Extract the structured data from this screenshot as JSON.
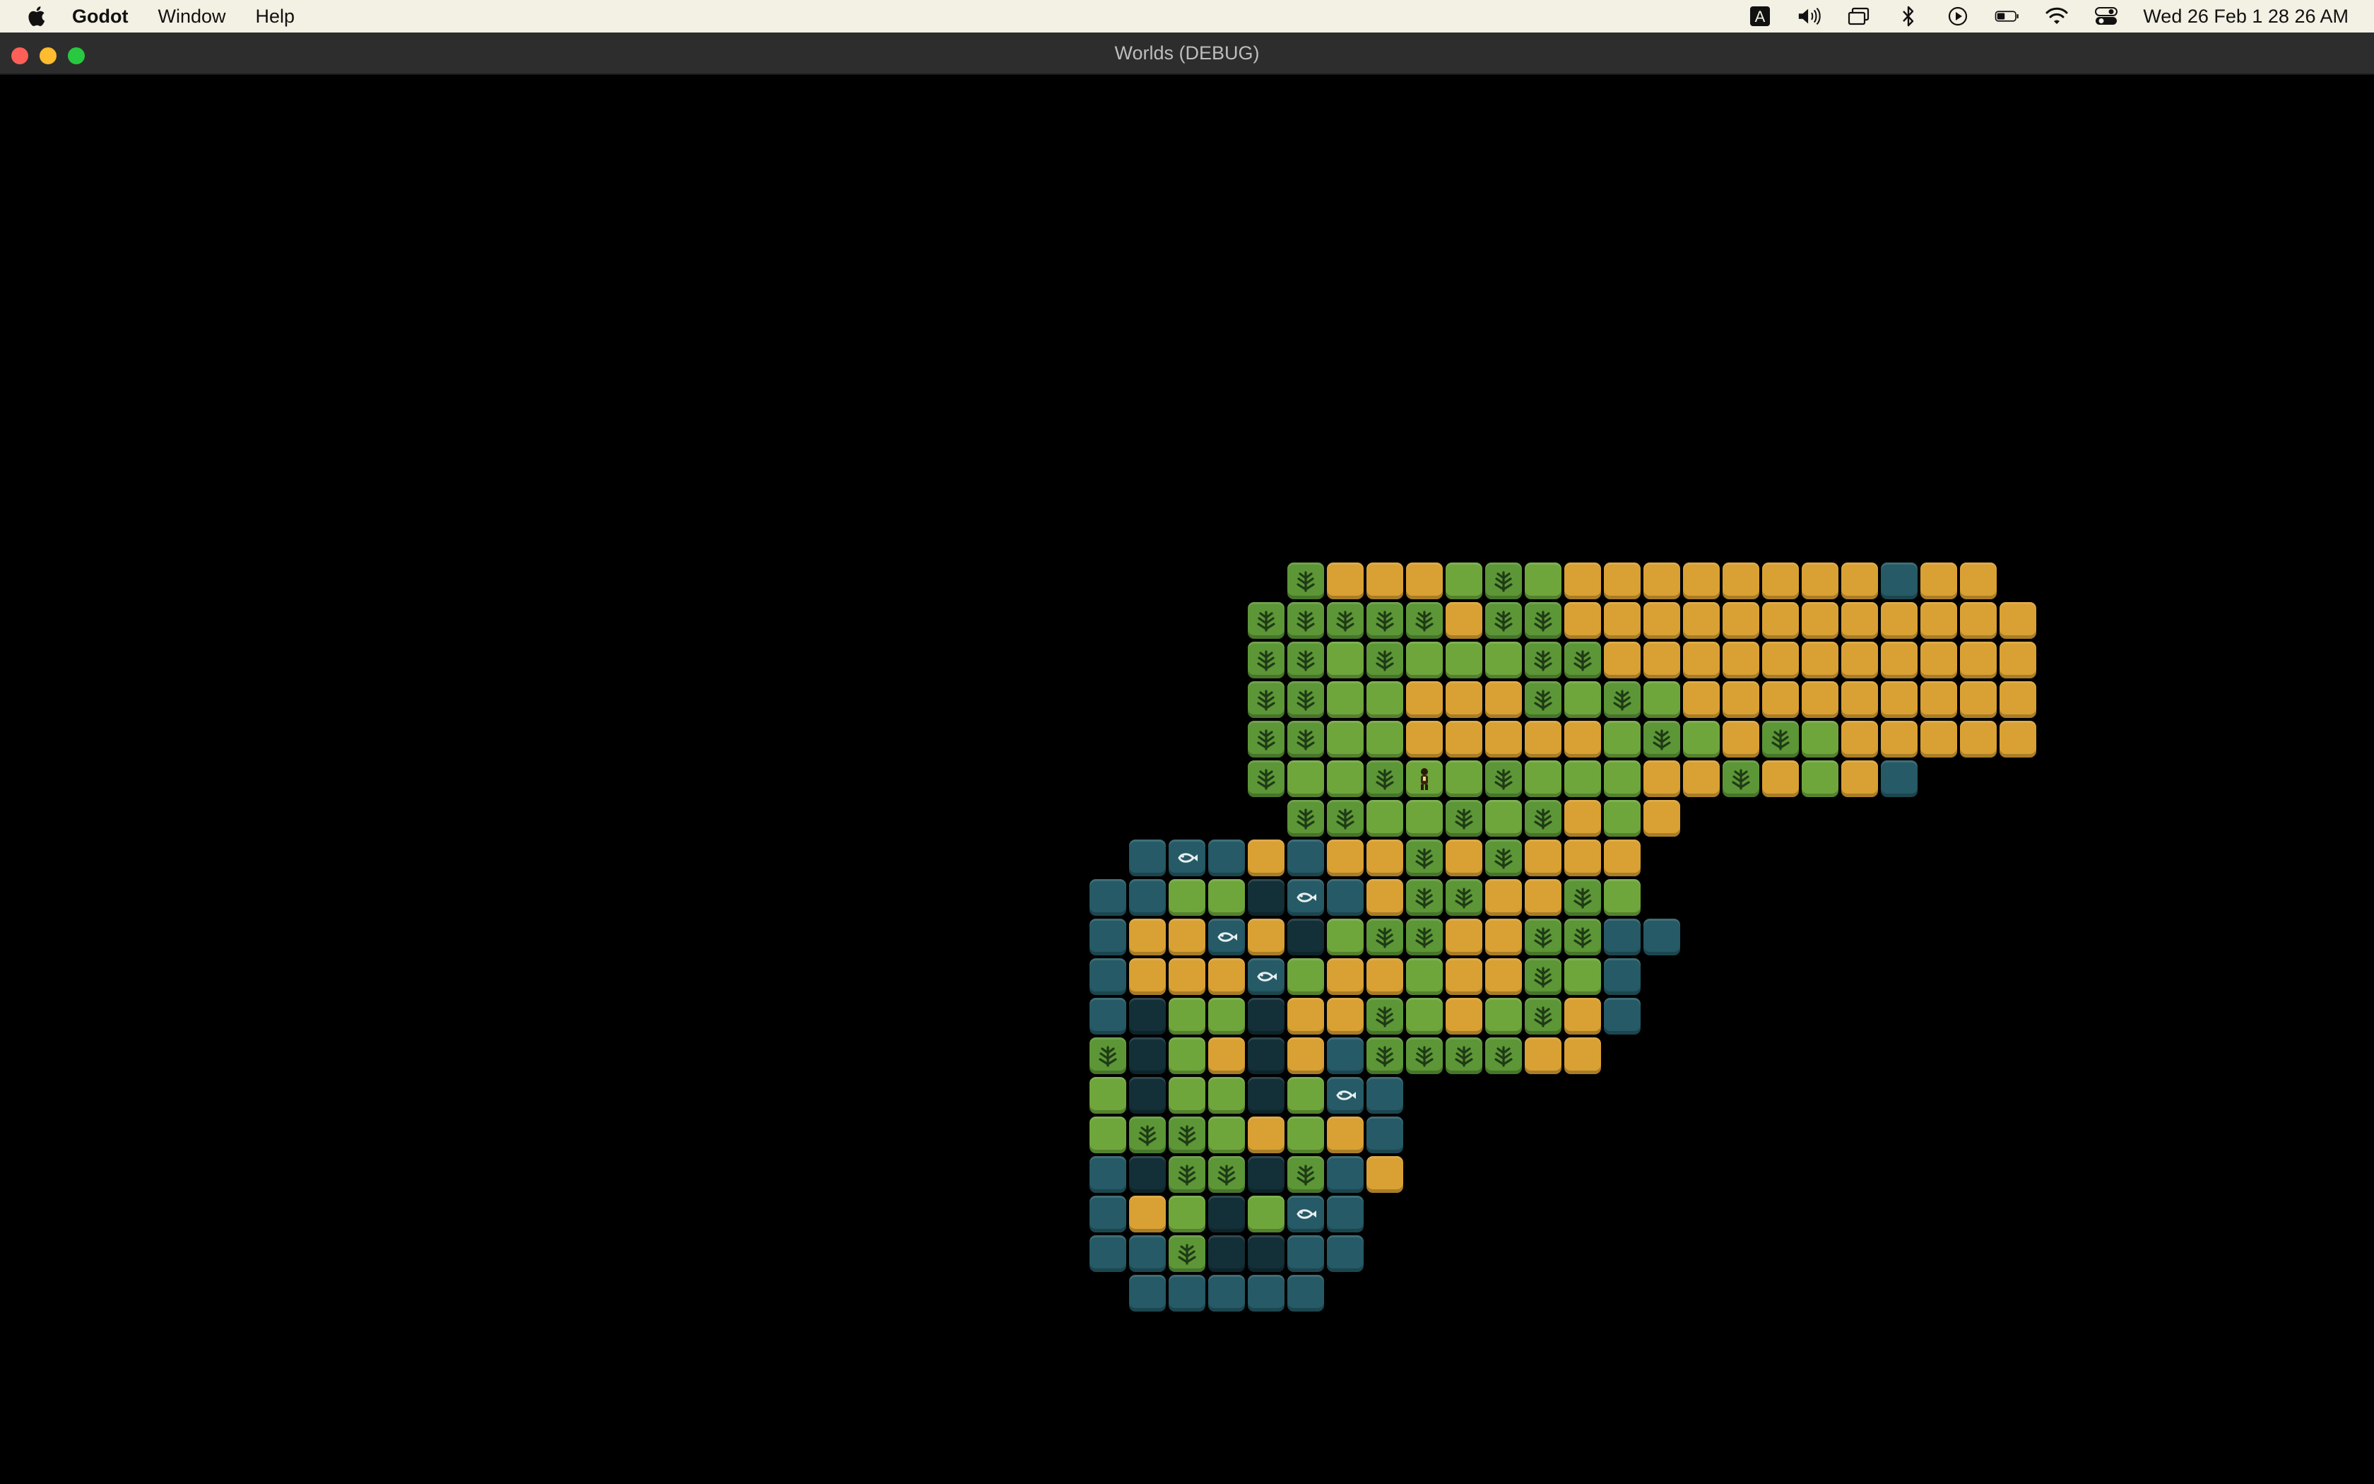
{
  "menubar": {
    "apple_icon": "apple-logo-icon",
    "app_name": "Godot",
    "items": [
      "Window",
      "Help"
    ],
    "status_icons": [
      "keyboard-input-a-icon",
      "volume-icon",
      "screen-mirroring-icon",
      "bluetooth-icon",
      "play-icon",
      "battery-icon",
      "wifi-icon",
      "control-center-icon"
    ],
    "input_source_letter": "A",
    "clock": "Wed 26 Feb  1 28 26 AM"
  },
  "window": {
    "title": "Worlds (DEBUG)"
  },
  "colors": {
    "sand": "#d9a033",
    "grass": "#6ea63c",
    "forest": "#5c9636",
    "water": "#255a66",
    "deep": "#132f38",
    "menubar": "#f3f0e4",
    "titlebar": "#2d2d2d"
  },
  "map": {
    "legend": {
      "S": "sand",
      "G": "grass",
      "T": "tree",
      "W": "water",
      "D": "deep-water",
      "F": "fish",
      "P": "player"
    },
    "rows": [
      "..........TSSSGTGSSSSSSSSWSS.",
      ".........TTTTTSTTSSSSSSSSSSSS",
      ".........TTGTGGGTTSSSSSSSSSSS",
      ".........TTGGSSSTGTGSSSSSSSSS",
      ".........TTGGSSSSSGTGSTGSSSSS",
      ".........TGGTPGTGGGSSTSGSW...",
      "..........TTGGTGTSGS.........",
      "......WFWSWSSTSTSSS..........",
      ".....WWGGDFWSTTSSTG..........",
      ".....WSSFSDGTTSSTTWW.........",
      ".....WSSSFGSSGSSTGW..........",
      ".....WDGGDSSTGSGTSW..........",
      ".....TDGSDSWTTTTSS...........",
      ".....GDGGDGFW................",
      ".....GTTGSGSW................",
      ".....WDTTDTWS................",
      ".....WSGDGFW.................",
      ".....WWTDDWW.................",
      "......WWWWW.................."
    ]
  }
}
